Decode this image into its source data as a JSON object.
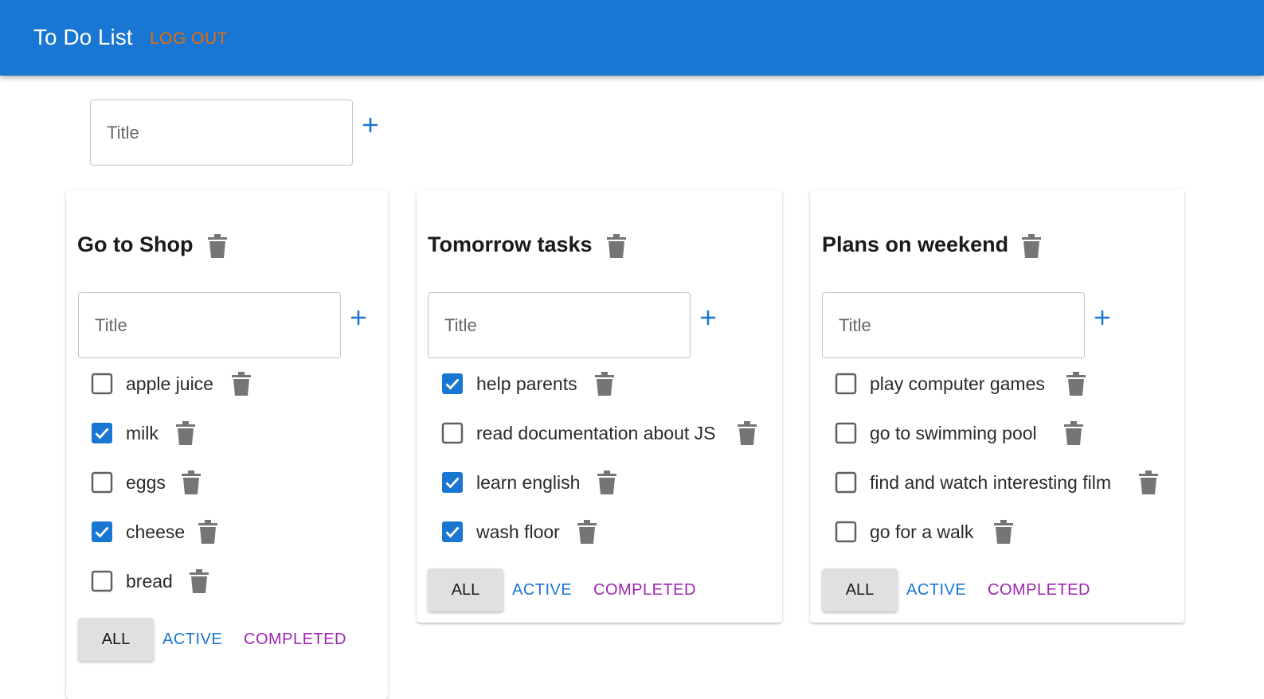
{
  "app": {
    "title": "To Do List",
    "logout_label": "LOG OUT"
  },
  "new_list": {
    "placeholder": "Title"
  },
  "colors": {
    "primary": "#1976d2",
    "logout": "#ed6c02",
    "completed": "#9c27b0",
    "icon": "#757575"
  },
  "lists": [
    {
      "title": "Go to Shop",
      "input_placeholder": "Title",
      "tasks": [
        {
          "label": "apple juice",
          "checked": false
        },
        {
          "label": "milk",
          "checked": true
        },
        {
          "label": "eggs",
          "checked": false
        },
        {
          "label": "cheese",
          "checked": true
        },
        {
          "label": "bread",
          "checked": false
        }
      ],
      "filters": {
        "all": "ALL",
        "active": "ACTIVE",
        "completed": "COMPLETED"
      }
    },
    {
      "title": "Tomorrow tasks",
      "input_placeholder": "Title",
      "tasks": [
        {
          "label": "help parents",
          "checked": true
        },
        {
          "label": "read documentation about JS",
          "checked": false
        },
        {
          "label": "learn english",
          "checked": true
        },
        {
          "label": "wash floor",
          "checked": true
        }
      ],
      "filters": {
        "all": "ALL",
        "active": "ACTIVE",
        "completed": "COMPLETED"
      }
    },
    {
      "title": "Plans on weekend",
      "input_placeholder": "Title",
      "tasks": [
        {
          "label": "play computer games",
          "checked": false
        },
        {
          "label": "go to swimming pool",
          "checked": false
        },
        {
          "label": "find and watch interesting film",
          "checked": false
        },
        {
          "label": "go for a walk",
          "checked": false
        }
      ],
      "filters": {
        "all": "ALL",
        "active": "ACTIVE",
        "completed": "COMPLETED"
      }
    }
  ]
}
